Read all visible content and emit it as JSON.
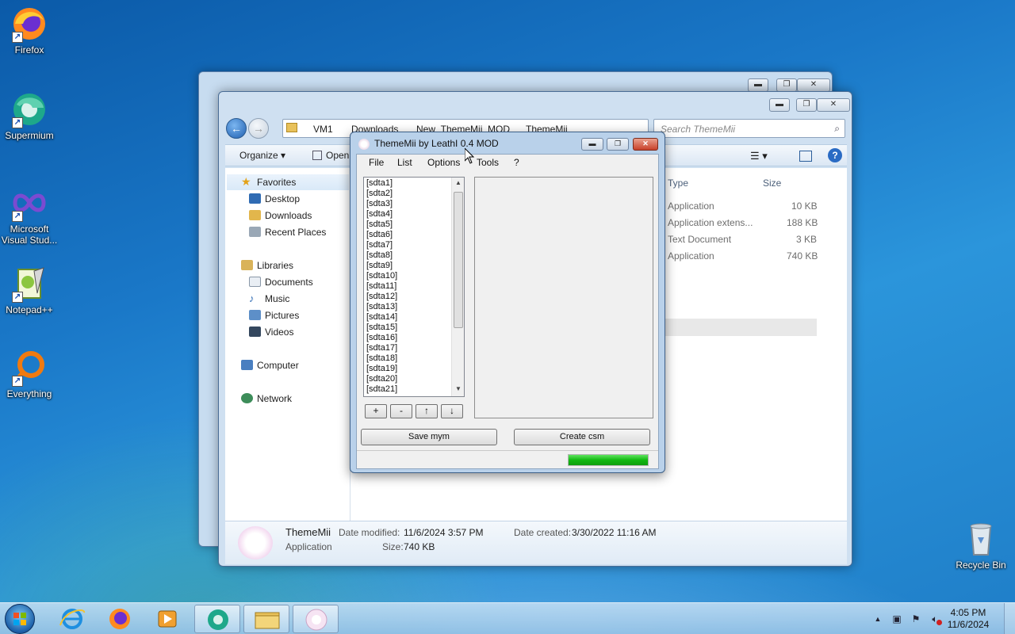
{
  "desktop_icons": [
    {
      "label": "Firefox"
    },
    {
      "label": "Supermium"
    },
    {
      "label": "Microsoft Visual Stud..."
    },
    {
      "label": "Notepad++"
    },
    {
      "label": "Everything"
    },
    {
      "label": "Recycle Bin"
    }
  ],
  "explorer": {
    "breadcrumb": [
      "VM1",
      "Downloads",
      "New_ThemeMii_MOD",
      "ThemeMii"
    ],
    "search_placeholder": "Search ThemeMii",
    "toolbar": {
      "organize": "Organize ▾",
      "open": "Open"
    },
    "nav": {
      "favorites": "Favorites",
      "desktop": "Desktop",
      "downloads": "Downloads",
      "recent": "Recent Places",
      "libraries": "Libraries",
      "documents": "Documents",
      "music": "Music",
      "pictures": "Pictures",
      "videos": "Videos",
      "computer": "Computer",
      "network": "Network"
    },
    "columns": {
      "type": "Type",
      "size": "Size"
    },
    "rows": [
      {
        "type": "Application",
        "size": "10 KB"
      },
      {
        "type": "Application extens...",
        "size": "188 KB"
      },
      {
        "type": "Text Document",
        "size": "3 KB"
      },
      {
        "type": "Application",
        "size": "740 KB"
      }
    ],
    "details": {
      "name": "ThemeMii",
      "kind": "Application",
      "date_modified_label": "Date modified:",
      "date_modified": "11/6/2024 3:57 PM",
      "size_label": "Size:",
      "size": "740 KB",
      "date_created_label": "Date created:",
      "date_created": "3/30/2022 11:16 AM"
    }
  },
  "dialog": {
    "title": "ThemeMii by LeathI 0.4 MOD",
    "menu": [
      "File",
      "List",
      "Options",
      "Tools",
      "?"
    ],
    "list_items": [
      "[sdta1]",
      "[sdta2]",
      "[sdta3]",
      "[sdta4]",
      "[sdta5]",
      "[sdta6]",
      "[sdta7]",
      "[sdta8]",
      "[sdta9]",
      "[sdta10]",
      "[sdta11]",
      "[sdta12]",
      "[sdta13]",
      "[sdta14]",
      "[sdta15]",
      "[sdta16]",
      "[sdta17]",
      "[sdta18]",
      "[sdta19]",
      "[sdta20]",
      "[sdta21]"
    ],
    "list_buttons": {
      "add": "+",
      "remove": "-",
      "up": "↑",
      "down": "↓"
    },
    "save_button": "Save mym",
    "create_button": "Create csm",
    "progress": 1.0
  },
  "taskbar": {
    "time": "4:05 PM",
    "date": "11/6/2024"
  },
  "colors": {
    "progress_fill": "#12b812",
    "close_button": "#c8412a",
    "wallpaper": "#1a78c8"
  }
}
